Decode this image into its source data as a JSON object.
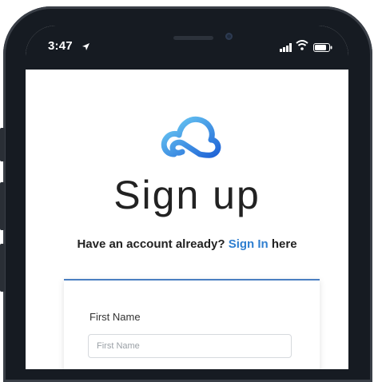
{
  "status_bar": {
    "time": "3:47"
  },
  "header": {
    "logo_icon": "cloud-icon",
    "title": "Sign up"
  },
  "subtitle": {
    "prefix": "Have an account already? ",
    "link": "Sign In",
    "suffix": " here"
  },
  "form": {
    "first_name_label": "First Name",
    "first_name_placeholder": "First Name",
    "first_name_value": ""
  },
  "colors": {
    "link": "#2f7fd0",
    "card_accent": "#4a7fc1",
    "frame": "#161b22"
  }
}
